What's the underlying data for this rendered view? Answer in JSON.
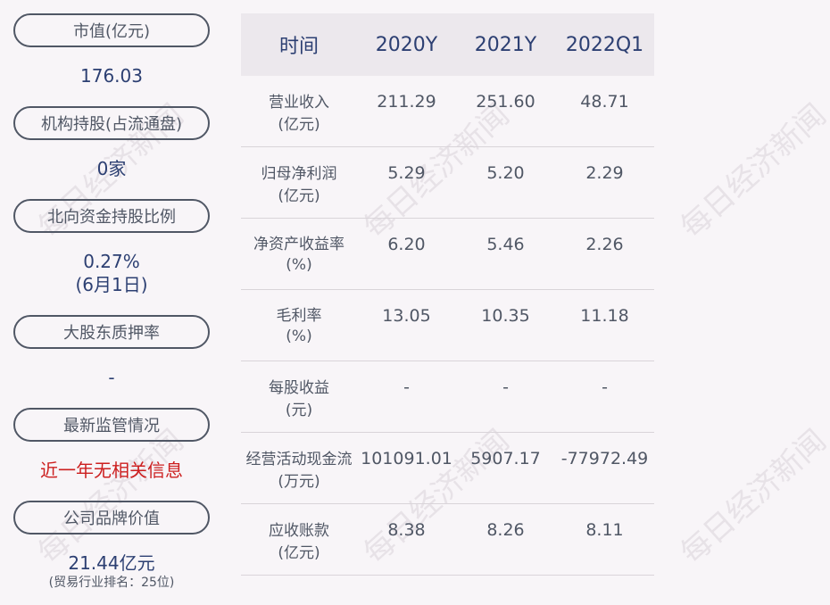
{
  "left": {
    "items": [
      {
        "label": "市值(亿元)",
        "value": "176.03"
      },
      {
        "label": "机构持股(占流通盘)",
        "value": "0家"
      },
      {
        "label": "北向资金持股比例",
        "value": "0.27%",
        "value2": "(6月1日)"
      },
      {
        "label": "大股东质押率",
        "value": "-"
      },
      {
        "label": "最新监管情况",
        "value": "近一年无相关信息"
      },
      {
        "label": "公司品牌价值",
        "value": "21.44亿元",
        "note": "(贸易行业排名：25位)"
      }
    ]
  },
  "table": {
    "headers": [
      "时间",
      "2020Y",
      "2021Y",
      "2022Q1"
    ],
    "rows": [
      {
        "name": "营业收入",
        "unit": "(亿元)",
        "values": [
          "211.29",
          "251.60",
          "48.71"
        ]
      },
      {
        "name": "归母净利润",
        "unit": "(亿元)",
        "values": [
          "5.29",
          "5.20",
          "2.29"
        ]
      },
      {
        "name": "净资产收益率",
        "unit": "(%)",
        "values": [
          "6.20",
          "5.46",
          "2.26"
        ]
      },
      {
        "name": "毛利率",
        "unit": "(%)",
        "values": [
          "13.05",
          "10.35",
          "11.18"
        ]
      },
      {
        "name": "每股收益",
        "unit": "(元)",
        "values": [
          "-",
          "-",
          "-"
        ]
      },
      {
        "name": "经营活动现金流",
        "unit": "(万元)",
        "values": [
          "101091.01",
          "5907.17",
          "-77972.49"
        ]
      },
      {
        "name": "应收账款",
        "unit": "(亿元)",
        "values": [
          "8.38",
          "8.26",
          "8.11"
        ]
      }
    ]
  },
  "watermark": "每日经济新闻",
  "colors": {
    "accent": "#2c3f72",
    "red": "#cc1f1f",
    "border": "#505765",
    "bg": "#f8f5f8"
  }
}
